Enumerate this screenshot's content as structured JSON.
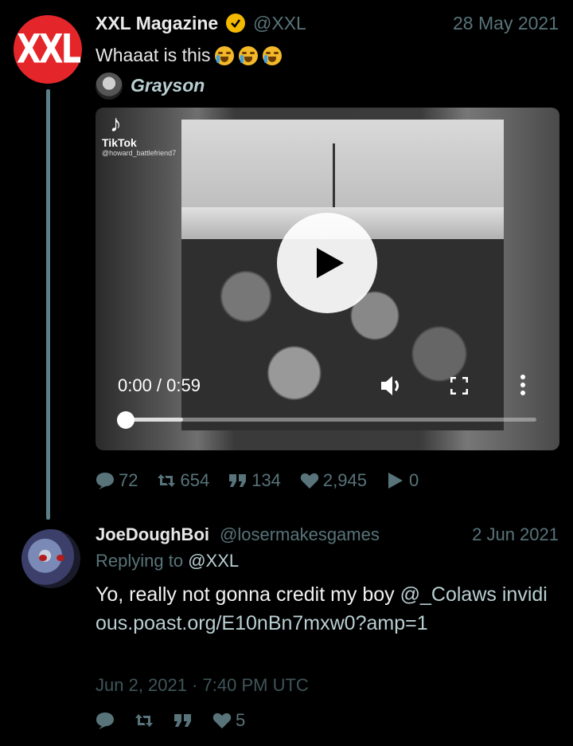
{
  "tweet1": {
    "author_name": "XXL Magazine",
    "author_handle": "@XXL",
    "date": "28 May 2021",
    "avatar_text": "XXL",
    "text": "Whaaat is this",
    "emoji": [
      "loudly-crying-face",
      "loudly-crying-face",
      "loudly-crying-face"
    ],
    "quote_name": "Grayson",
    "video": {
      "overlay_brand": "TikTok",
      "overlay_handle": "@howard_battlefriend7",
      "time": "0:00 / 0:59",
      "progress": 0.0,
      "buffered": 0.14
    },
    "stats": {
      "replies": "72",
      "retweets": "654",
      "quotes": "134",
      "likes": "2,945",
      "plays": "0"
    }
  },
  "tweet2": {
    "author_name": "JoeDoughBoi",
    "author_handle": "@losermakesgames",
    "date": "2 Jun 2021",
    "replying_prefix": "Replying to",
    "replying_to": "@XXL",
    "text_before": "Yo, really not gonna credit my boy ",
    "mention": "@_Colaws",
    "link": "invidious.poast.org/E10nBn7mxw0?amp=1",
    "timestamp": "Jun 2, 2021 · 7:40 PM UTC",
    "stats": {
      "likes": "5"
    }
  },
  "colors": {
    "background": "#000000",
    "accent": "#b9cfd2",
    "muted": "#58747a",
    "thread_line": "#5a7f86",
    "xxl_red": "#e4262b",
    "verified": "#f2b900"
  }
}
